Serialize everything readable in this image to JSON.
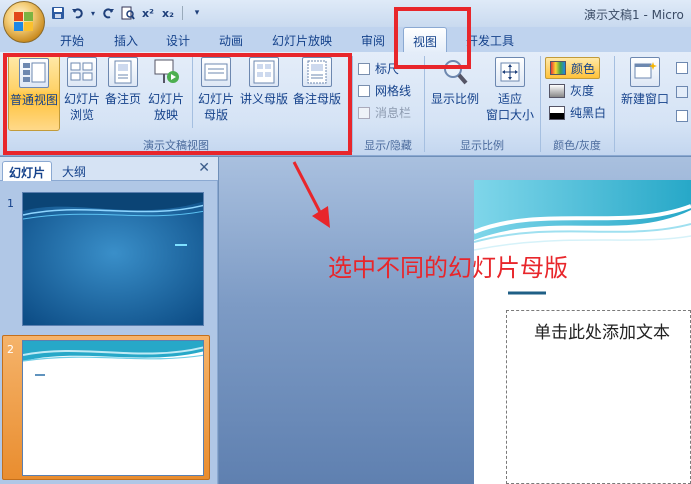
{
  "title": {
    "text": "演示文稿1 - Micro"
  },
  "tabs": [
    "开始",
    "插入",
    "设计",
    "动画",
    "幻灯片放映",
    "审阅",
    "视图",
    "开发工具"
  ],
  "active_tab": "视图",
  "ribbon": {
    "presentation_views": {
      "label": "演示文稿视图",
      "buttons": [
        "普通视图",
        "幻灯片\n浏览",
        "备注页",
        "幻灯片\n放映",
        "幻灯片\n母版",
        "讲义母版",
        "备注母版"
      ]
    },
    "show_hide": {
      "label": "显示/隐藏",
      "items": [
        "标尺",
        "网格线",
        "消息栏"
      ]
    },
    "zoom": {
      "label": "显示比例",
      "buttons": [
        "显示比例",
        "适应\n窗口大小"
      ]
    },
    "color": {
      "label": "颜色/灰度",
      "items": [
        "颜色",
        "灰度",
        "纯黑白"
      ]
    },
    "window": {
      "new_window": "新建窗口"
    }
  },
  "left_pane": {
    "tabs": [
      "幻灯片",
      "大纲"
    ],
    "close": "✕",
    "slide_numbers": [
      "1",
      "2"
    ]
  },
  "slide": {
    "placeholder": "单击此处添加文本"
  },
  "annotation": {
    "text": "选中不同的幻灯片母版"
  },
  "colors": {
    "annotation": "#e8262b",
    "accent": "#ffc23a",
    "ribbon_text": "#15428b"
  }
}
